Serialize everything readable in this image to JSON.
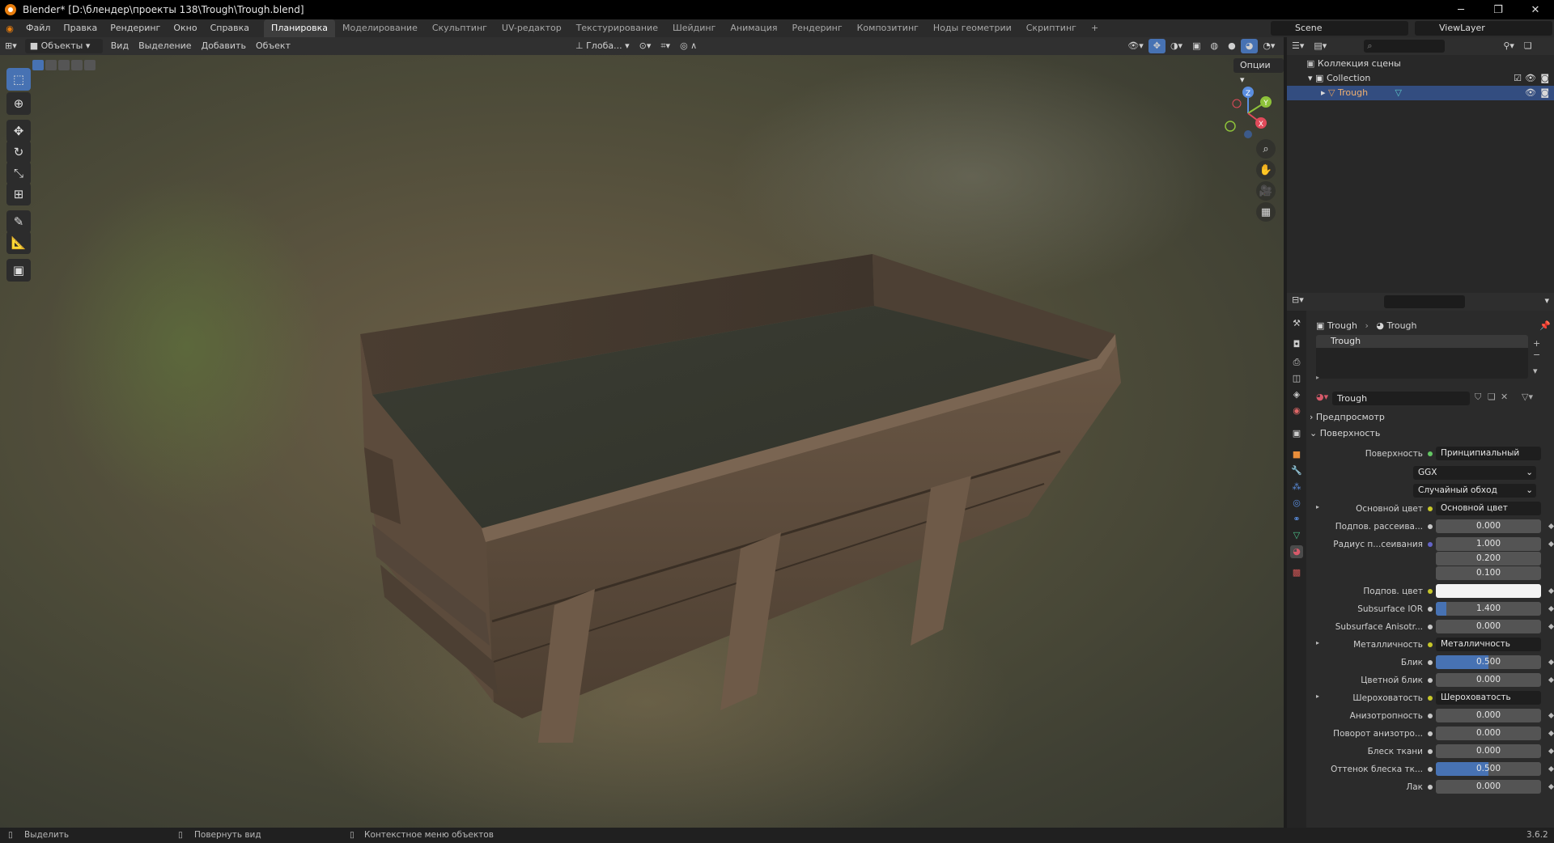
{
  "window": {
    "title": "Blender* [D:\\блендер\\проекты 138\\Trough\\Trough.blend]"
  },
  "menu": [
    "Файл",
    "Правка",
    "Рендеринг",
    "Окно",
    "Справка"
  ],
  "workspaces": [
    "Планировка",
    "Моделирование",
    "Скульптинг",
    "UV-редактор",
    "Текстурирование",
    "Шейдинг",
    "Анимация",
    "Рендеринг",
    "Композитинг",
    "Ноды геометрии",
    "Скриптинг"
  ],
  "active_workspace": "Планировка",
  "scene": "Scene",
  "view_layer": "ViewLayer",
  "viewport_header": {
    "mode": "Объекты",
    "view": "Вид",
    "select": "Выделение",
    "add": "Добавить",
    "object": "Объект",
    "transform": "Глоба...",
    "options": "Опции"
  },
  "gizmo_axes": {
    "x": "X",
    "y": "Y",
    "z": "Z"
  },
  "outliner": {
    "scene_collection": "Коллекция сцены",
    "collection": "Collection",
    "object": "Trough"
  },
  "properties": {
    "breadcrumb_object": "Trough",
    "breadcrumb_material": "Trough",
    "slot": "Trough",
    "material_name": "Trough",
    "section_preview": "Предпросмотр",
    "section_surface": "Поверхность",
    "surface": {
      "label": "Поверхность",
      "value": "Принципиальный BSDF"
    },
    "distribution": "GGX",
    "subsurface_method": "Случайный обход",
    "rows": [
      {
        "label": "Основной цвет",
        "value": "Основной цвет"
      },
      {
        "label": "Подпов. рассеива...",
        "value": "0.000"
      },
      {
        "label": "Радиус п...сеивания",
        "value": "1.000"
      },
      {
        "label": "",
        "value": "0.200"
      },
      {
        "label": "",
        "value": "0.100"
      },
      {
        "label": "Подпов. цвет",
        "value": ""
      },
      {
        "label": "Subsurface IOR",
        "value": "1.400"
      },
      {
        "label": "Subsurface Anisotr...",
        "value": "0.000"
      },
      {
        "label": "Металличность",
        "value": "Металличность"
      },
      {
        "label": "Блик",
        "value": "0.500"
      },
      {
        "label": "Цветной блик",
        "value": "0.000"
      },
      {
        "label": "Шероховатость",
        "value": "Шероховатость"
      },
      {
        "label": "Анизотропность",
        "value": "0.000"
      },
      {
        "label": "Поворот анизотро...",
        "value": "0.000"
      },
      {
        "label": "Блеск ткани",
        "value": "0.000"
      },
      {
        "label": "Оттенок блеска тк...",
        "value": "0.500"
      },
      {
        "label": "Лак",
        "value": "0.000"
      }
    ]
  },
  "status": {
    "select": "Выделить",
    "rotate": "Повернуть вид",
    "context": "Контекстное меню объектов",
    "version": "3.6.2"
  },
  "colors": {
    "accent": "#4772b3",
    "selection": "#334d80",
    "orange": "#e87d0d"
  }
}
